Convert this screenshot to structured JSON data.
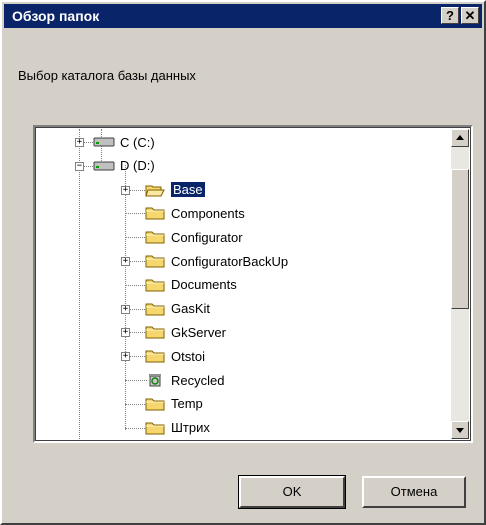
{
  "window": {
    "title": "Обзор папок",
    "help_label": "?",
    "close_label": "✕"
  },
  "prompt": "Выбор каталога базы данных",
  "tree": {
    "drives": [
      {
        "label": "C (C:)",
        "expander": "+"
      },
      {
        "label": "D (D:)",
        "expander": "−"
      }
    ],
    "folders": [
      {
        "label": "Base",
        "expander": "+",
        "selected": true,
        "icon": "folder-open-icon"
      },
      {
        "label": "Components",
        "expander": "",
        "icon": "folder-icon"
      },
      {
        "label": "Configurator",
        "expander": "",
        "icon": "folder-icon"
      },
      {
        "label": "ConfiguratorBackUp",
        "expander": "+",
        "icon": "folder-icon"
      },
      {
        "label": "Documents",
        "expander": "",
        "icon": "folder-icon"
      },
      {
        "label": "GasKit",
        "expander": "+",
        "icon": "folder-icon"
      },
      {
        "label": "GkServer",
        "expander": "+",
        "icon": "folder-icon"
      },
      {
        "label": "Otstoi",
        "expander": "+",
        "icon": "folder-icon"
      },
      {
        "label": "Recycled",
        "expander": "",
        "icon": "recycle-bin-icon"
      },
      {
        "label": "Temp",
        "expander": "",
        "icon": "folder-icon"
      },
      {
        "label": "Штрих",
        "expander": "",
        "icon": "folder-icon"
      }
    ]
  },
  "buttons": {
    "ok": "OK",
    "cancel": "Отмена"
  },
  "colors": {
    "titlebar": "#0a246a",
    "face": "#d4d0c8",
    "folder": "#f5d76e",
    "selection": "#0a246a"
  }
}
